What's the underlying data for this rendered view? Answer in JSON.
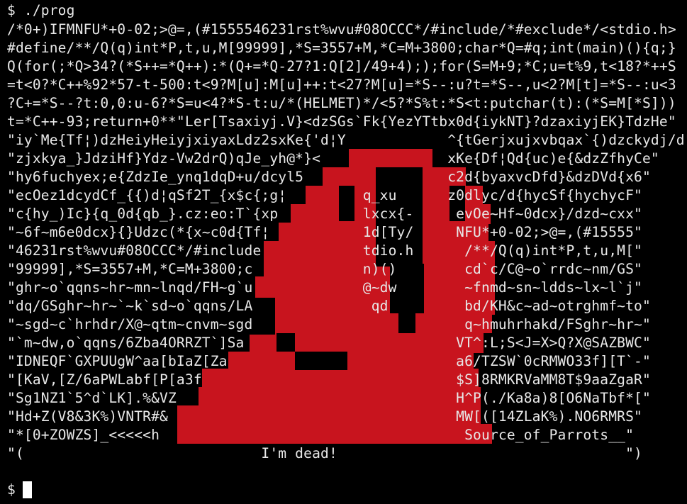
{
  "terminal": {
    "prompt_line": "$ ./prog",
    "output_lines": [
      "/*0+)IFMNFU*+0-02;>@=,(#1555546231rst%wvu#08OCCC*/#include/*#exclude*/<stdio.h>",
      "#define/**/Q(q)int*P,t,u,M[99999],*S=3557+M,*C=M+3800;char*Q=#q;int(main)(){q;}",
      "Q(for(;*Q>34?(*S++=*Q++):*(Q+=*Q-27?1:Q[2]/49+4););for(S=M+9;*C;u=t%9,t<18?*++S",
      "=t<0?*C++%92*57-t-500:t<9?M[u]:M[u]++:t<27?M[u]=*S--:u?t=*S--,u<2?M[t]=*S--:u<3",
      "?C+=*S--?t:0,0:u-6?*S=u<4?*S-t:u/*(HELMET)*/<5?*S%t:*S<t:putchar(t):(*S=M[*S]))",
      "t=*C++-93;return+0**\"Ler[Tsaxiyj.V}<dzSGs`Fk{YezYTtbx0d{iykNT}?dzaxiyjEK}TdzHe\"",
      "\"iy`Me{Tf¦)dzHeiyHeiyjxiyaxLdz2sxKe{'d¦Y            ^{tGerjxujxvbqax`{)dzckydj/d\"",
      "\"zjxkya_}JdziHf}Ydz-Vw2drQ)qJe_yh@*}<               xKe{Df¦Qd{uc)e{&dzZfhyCe\"",
      "\"hy6fuchyex;e{ZdzIe_ynq1dqD+u/dcyl5                 c2d{byaxvcDfd}&dzDVd{x6\"",
      "\"ecOez1dcydCf_{{)d¦qSf2T_{x$c{;g¦         q_xu      z0dlyc/d{hycSf{hychycF\"",
      "\"c{hy_)Ic}{q_0d{qb_}.cz:eo:T`{xp          lxcx{-     evOe~Hf~0dcx}/dzd~cxx\"",
      "\"~6f~m6e0dcx}{}Udzc(*{x~c0d{Tf¦           1d[Ty/     NFU*+0-02;>@=,(#15555\"",
      "\"46231rst%wvu#08OCCC*/#include            tdio.h      /**/Q(q)int*P,t,u,M[\"",
      "\"99999],*S=3557+M,*C=M+3800;c             n)()        cd`c/C@~o`rrdc~nm/GS\"",
      "\"ghr~o`qqns~hr~mn~lnqd/FH~g`u             @~dw        ~fnmd~sn~ldds~lx~l`j\"",
      "\"dq/GSghr~hr~`~k`sd~o`qqns/LA              qd         bd/KH&c~ad~otrghmf~to\"",
      "\"~sgd~c`hrhdr/X@~qtm~cnvm~sgd                         q~hmuhrhakd/FSghr~hr~\"",
      "\"`m~dw,o`qqns/6Zba4ORRZT`]Sa                         VT^:L;S<J=X>Q?X@SAZBWC\"",
      "\"IDNEQF`GXPUUgW^aa[bIaZ[Za                           a6/TZSW`0cRMWO33f][T`-\"",
      "\"[KaV,[Z/6aPWLabf[P[a3f                              $S]8RMKRVaMM8T$9aaZgaR\"",
      "\"Sg1NZ1`5^d`LK].%&VZ                                 H^P(./Ka8a)8[O6NaTbf*[\"",
      "\"Hd+Z(V8&3K%)VNTR#&                                  MW[([14ZLaK%).NO6RMRS\"",
      "\"*[0+ZOWZS]_<<<<<h                                    Source_of_Parrots__\"",
      "\"(                            I'm dead!                                  \")"
    ],
    "next_prompt": "$",
    "colors": {
      "background": "#000000",
      "text": "#e8e8e8",
      "parrot": "#c8141e",
      "cursor": "#ffffff"
    }
  }
}
